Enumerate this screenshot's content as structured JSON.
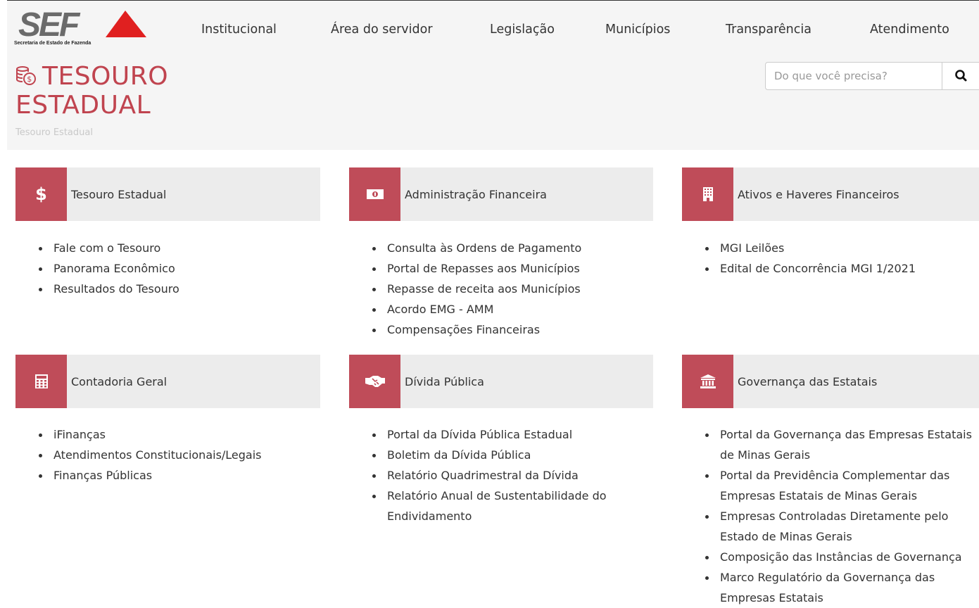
{
  "header": {
    "logo_text": "SEF",
    "logo_subtitle": "Secretaria de Estado de Fazenda",
    "nav": [
      "Institucional",
      "Área do servidor",
      "Legislação",
      "Municípios",
      "Transparência",
      "Atendimento"
    ]
  },
  "page": {
    "title": "TESOURO ESTADUAL",
    "breadcrumb": "Tesouro Estadual"
  },
  "search": {
    "placeholder": "Do que você precisa?"
  },
  "sections": [
    {
      "title": "Tesouro Estadual",
      "icon": "dollar-icon",
      "links": [
        "Fale com o Tesouro",
        "Panorama Econômico",
        "Resultados do Tesouro"
      ]
    },
    {
      "title": "Administração Financeira",
      "icon": "money-bill-icon",
      "links": [
        "Consulta às Ordens de Pagamento",
        "Portal de Repasses aos Municípios",
        "Repasse de receita aos Municípios",
        "Acordo EMG - AMM",
        "Compensações Financeiras"
      ]
    },
    {
      "title": "Ativos e Haveres Financeiros",
      "icon": "building-icon",
      "links": [
        "MGI Leilões",
        "Edital de Concorrência MGI 1/2021"
      ]
    },
    {
      "title": "Contadoria Geral",
      "icon": "calculator-icon",
      "links": [
        "iFinanças",
        "Atendimentos Constitucionais/Legais",
        "Finanças Públicas"
      ]
    },
    {
      "title": "Dívida Pública",
      "icon": "handshake-icon",
      "links": [
        "Portal da Dívida Pública Estadual",
        "Boletim da Dívida Pública",
        "Relatório Quadrimestral da Dívida",
        "Relatório Anual de Sustentabilidade do Endividamento"
      ]
    },
    {
      "title": "Governança das Estatais",
      "icon": "institution-icon",
      "links": [
        "Portal da Governança das Empresas Estatais de Minas Gerais",
        "Portal da Previdência Complementar das Empresas Estatais de Minas Gerais",
        "Empresas Controladas Diretamente pelo Estado de Minas Gerais",
        "Composição das Instâncias de Governança",
        "Marco Regulatório da Governança das Empresas Estatais"
      ]
    }
  ],
  "colors": {
    "accent": "#bf4c59",
    "title": "#c0444f",
    "logo_triangle": "#e02020",
    "panel_bg": "#f5f5f5",
    "card_bg": "#ececec"
  }
}
